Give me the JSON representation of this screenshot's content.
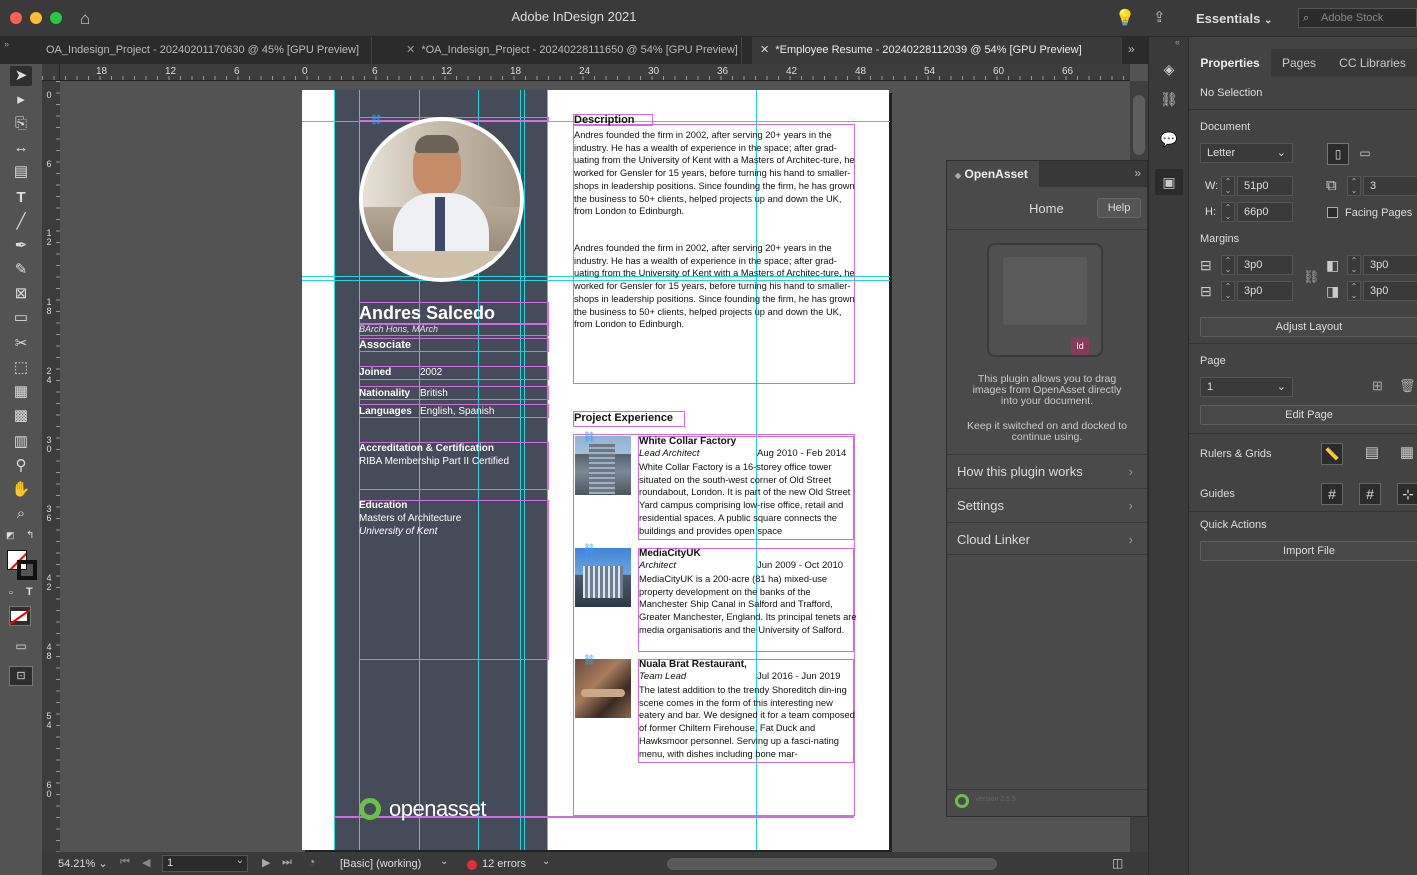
{
  "app": {
    "title": "Adobe InDesign 2021",
    "workspace": "Essentials",
    "stock_placeholder": "Adobe Stock"
  },
  "tabs": [
    {
      "label": "OA_Indesign_Project - 20240201170630 @ 45% [GPU Preview]"
    },
    {
      "label": "*OA_Indesign_Project - 20240228111650 @ 54% [GPU Preview]"
    },
    {
      "label": "*Employee Resume - 20240228112039 @ 54% [GPU Preview]"
    }
  ],
  "ruler_top": [
    "18",
    "12",
    "6",
    "0",
    "6",
    "12",
    "18",
    "24",
    "30",
    "36",
    "42",
    "48",
    "54",
    "60",
    "66"
  ],
  "ruler_left": [
    "0",
    "6",
    "1 2",
    "1 8",
    "2 4",
    "3 0",
    "3 6",
    "4 2",
    "4 8",
    "5 4",
    "6 0"
  ],
  "resume": {
    "name": "Andres Salcedo",
    "degrees": "BArch Hons, MArch",
    "title": "Associate",
    "joined_label": "Joined",
    "joined": "2002",
    "nationality_label": "Nationality",
    "nationality": "British",
    "languages_label": "Languages",
    "languages": "English, Spanish",
    "accreditation_label": "Accreditation & Certification",
    "accreditation": "RIBA Membership Part II Certified",
    "education_label": "Education",
    "education_degree": "Masters of Architecture",
    "education_school": "University of Kent",
    "logo": "openasset",
    "description_heading": "Description",
    "description_1": "Andres founded the firm in 2002, after serving 20+ years in the industry. He has a wealth of experience in the space; after grad-uating from the University of Kent with a Masters of Architec-ture, he worked for Gensler for 15 years, before turning his hand to smaller-shops in leadership positions. Since founding the firm, he has grown the business to 50+ clients, helped projects up and down the UK, from London to Edinburgh.",
    "description_2": "Andres founded the firm in 2002, after serving 20+ years in the industry. He has a wealth of experience in the space; after grad-uating from the University of Kent with a Masters of Architec-ture, he worked for Gensler for 15 years, before turning his hand to smaller-shops in leadership positions. Since founding the firm, he has grown the business to 50+ clients, helped projects up and down the UK, from London to Edinburgh.",
    "projects_heading": "Project Experience",
    "projects": [
      {
        "name": "White Collar Factory",
        "role": "Lead Architect",
        "dates": "Aug 2010 - Feb 2014",
        "text": "White Collar Factory is a 16-storey office tower situated on the south-west corner of Old Street roundabout, London.  It is part of the new Old Street Yard campus comprising low-rise office, retail and residential spaces. A public square connects the buildings and provides open space"
      },
      {
        "name": "MediaCityUK",
        "role": "Architect",
        "dates": "Jun 2009 - Oct 2010",
        "text": "MediaCityUK is a 200-acre (81 ha) mixed-use property development on the banks of the Manchester Ship Canal in Salford and Trafford, Greater Manchester, England. Its principal tenets are media organisations and the University of Salford."
      },
      {
        "name": "Nuala Brat Restaurant,",
        "role": "Team Lead",
        "dates": "Jul 2016 - Jun 2019",
        "text": "The latest addition to the trendy Shoreditch din-ing scene comes in the form of this interesting new eatery and bar. We designed it for a team composed of former Chiltern Firehouse, Fat Duck and Hawksmoor personnel. Serving up a fasci-nating menu, with dishes including bone mar-"
      }
    ]
  },
  "openasset": {
    "title": "OpenAsset",
    "home": "Home",
    "help": "Help",
    "info_1": "This plugin allows you to drag images from OpenAsset directly into your document.",
    "info_2": "Keep it switched on and docked to continue using.",
    "menu": [
      "How this plugin works",
      "Settings",
      "Cloud Linker"
    ],
    "version": "Version 2.5.5"
  },
  "properties": {
    "tabs": [
      "Properties",
      "Pages",
      "CC Libraries"
    ],
    "selection": "No Selection",
    "document_label": "Document",
    "page_size": "Letter",
    "w_label": "W:",
    "w": "51p0",
    "h_label": "H:",
    "h": "66p0",
    "pages_count": "3",
    "facing_pages": "Facing Pages",
    "margins_label": "Margins",
    "margin_top": "3p0",
    "margin_bottom": "3p0",
    "margin_left": "3p0",
    "margin_right": "3p0",
    "adjust_layout": "Adjust Layout",
    "page_label": "Page",
    "page_value": "1",
    "edit_page": "Edit Page",
    "rulers_grids": "Rulers & Grids",
    "guides": "Guides",
    "quick_actions": "Quick Actions",
    "import_file": "Import File"
  },
  "status": {
    "zoom": "54.21%",
    "page": "1",
    "profile": "[Basic] (working)",
    "errors": "12 errors"
  },
  "colors": {
    "sidebar": "#454b58",
    "accent_green": "#6cc04a",
    "error_red": "#e03030"
  }
}
